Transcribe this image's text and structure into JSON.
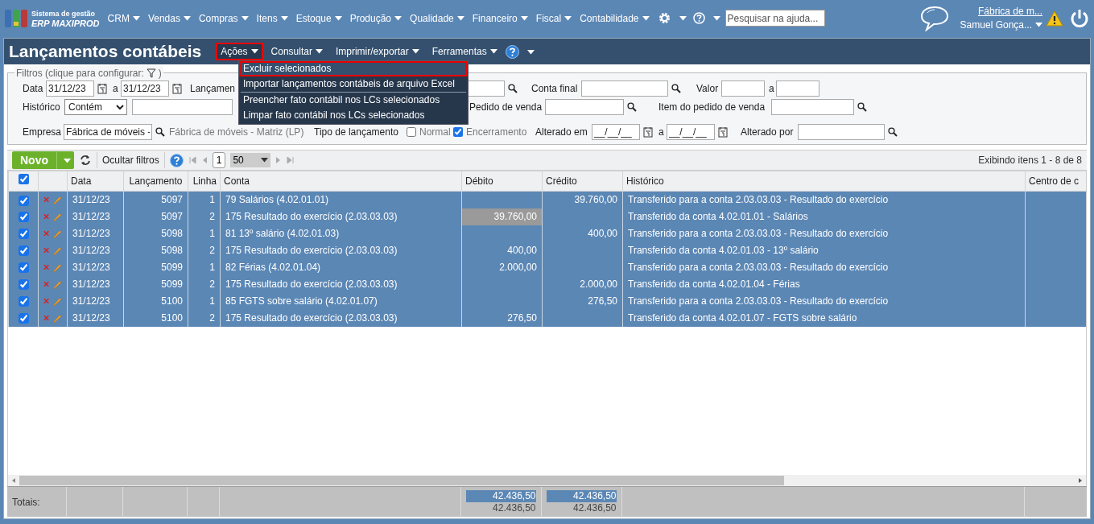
{
  "brand": {
    "line1": "Sistema de gestão",
    "line2": "ERP MAXIPROD"
  },
  "nav": [
    "CRM",
    "Vendas",
    "Compras",
    "Itens",
    "Estoque",
    "Produção",
    "Qualidade",
    "Financeiro",
    "Fiscal",
    "Contabilidade"
  ],
  "help_search": {
    "placeholder": "Pesquisar na ajuda..."
  },
  "user": {
    "company": "Fábrica de m...",
    "name": "Samuel Gonça..."
  },
  "page_title": "Lançamentos contábeis",
  "toolbar_menus": [
    {
      "label": "Ações",
      "selected": true
    },
    {
      "label": "Consultar",
      "selected": false
    },
    {
      "label": "Imprimir/exportar",
      "selected": false
    },
    {
      "label": "Ferramentas",
      "selected": false
    }
  ],
  "dropdown": [
    {
      "label": "Excluir selecionados",
      "selected": true,
      "separator_after": false
    },
    {
      "label": "Importar lançamentos contábeis de arquivo Excel",
      "selected": false,
      "separator_after": true
    },
    {
      "label": "Preencher fato contábil nos LCs selecionados",
      "selected": false,
      "separator_after": false
    },
    {
      "label": "Limpar fato contábil nos LCs selecionados",
      "selected": false,
      "separator_after": false
    }
  ],
  "filters": {
    "legend": "Filtros (clique para configurar:",
    "legend_end": ")",
    "data_label": "Data",
    "data_from": "31/12/23",
    "data_sep": "a",
    "data_to": "31/12/23",
    "lanc_label": "Lançamen",
    "conta_final_label": "Conta final",
    "valor_label": "Valor",
    "valor_sep": "a",
    "historico_label": "Histórico",
    "historico_mode": "Contém",
    "pedido_label": "Pedido de venda",
    "item_pedido_label": "Item do pedido de venda",
    "empresa_label": "Empresa",
    "empresa_value": "Fábrica de móveis -",
    "empresa_name": "Fábrica de móveis - Matriz (LP)",
    "tipo_label": "Tipo de lançamento",
    "tipo_options": [
      {
        "label": "Normal",
        "checked": false
      },
      {
        "label": "Encerramento",
        "checked": true
      }
    ],
    "alterado_em_label": "Alterado em",
    "alterado_from": "__/__/__",
    "alterado_sep": "a",
    "alterado_to": "__/__/__",
    "alterado_por_label": "Alterado por"
  },
  "grid_toolbar": {
    "new_button": "Novo",
    "hide_filters": "Ocultar filtros",
    "page": "1",
    "page_size": "50",
    "summary": "Exibindo itens 1 - 8 de 8"
  },
  "table": {
    "all_checked": true,
    "columns": [
      "Data",
      "Lançamento",
      "Linha",
      "Conta",
      "Débito",
      "Crédito",
      "Histórico",
      "Centro de c"
    ],
    "rows": [
      {
        "selected": true,
        "checked": true,
        "date": "31/12/23",
        "entry": "5097",
        "line": "1",
        "account": "79 Salários (4.02.01.01)",
        "debit": "",
        "debit_highlighted": false,
        "credit": "39.760,00",
        "history": "Transferido para a conta 2.03.03.03 - Resultado do exercício"
      },
      {
        "selected": true,
        "checked": true,
        "date": "31/12/23",
        "entry": "5097",
        "line": "2",
        "account": "175 Resultado do exercício (2.03.03.03)",
        "debit": "39.760,00",
        "debit_highlighted": true,
        "credit": "",
        "history": "Transferido da conta 4.02.01.01 - Salários"
      },
      {
        "selected": true,
        "checked": true,
        "date": "31/12/23",
        "entry": "5098",
        "line": "1",
        "account": "81 13º salário (4.02.01.03)",
        "debit": "",
        "debit_highlighted": false,
        "credit": "400,00",
        "history": "Transferido para a conta 2.03.03.03 - Resultado do exercício"
      },
      {
        "selected": true,
        "checked": true,
        "date": "31/12/23",
        "entry": "5098",
        "line": "2",
        "account": "175 Resultado do exercício (2.03.03.03)",
        "debit": "400,00",
        "debit_highlighted": false,
        "credit": "",
        "history": "Transferido da conta 4.02.01.03 - 13º salário"
      },
      {
        "selected": true,
        "checked": true,
        "date": "31/12/23",
        "entry": "5099",
        "line": "1",
        "account": "82 Férias (4.02.01.04)",
        "debit": "2.000,00",
        "debit_highlighted": false,
        "credit": "",
        "history": "Transferido para a conta 2.03.03.03 - Resultado do exercício"
      },
      {
        "selected": true,
        "checked": true,
        "date": "31/12/23",
        "entry": "5099",
        "line": "2",
        "account": "175 Resultado do exercício (2.03.03.03)",
        "debit": "",
        "debit_highlighted": false,
        "credit": "2.000,00",
        "history": "Transferido da conta 4.02.01.04 - Férias"
      },
      {
        "selected": true,
        "checked": true,
        "date": "31/12/23",
        "entry": "5100",
        "line": "1",
        "account": "85 FGTS sobre salário (4.02.01.07)",
        "debit": "",
        "debit_highlighted": false,
        "credit": "276,50",
        "history": "Transferido para a conta 2.03.03.03 - Resultado do exercício"
      },
      {
        "selected": true,
        "checked": true,
        "date": "31/12/23",
        "entry": "5100",
        "line": "2",
        "account": "175 Resultado do exercício (2.03.03.03)",
        "debit": "276,50",
        "debit_highlighted": false,
        "credit": "",
        "history": "Transferido da conta 4.02.01.07 - FGTS sobre salário"
      }
    ],
    "totals": {
      "label": "Totais:",
      "debit_selected": "42.436,50",
      "debit_total": "42.436,50",
      "credit_selected": "42.436,50",
      "credit_total": "42.436,50"
    }
  }
}
